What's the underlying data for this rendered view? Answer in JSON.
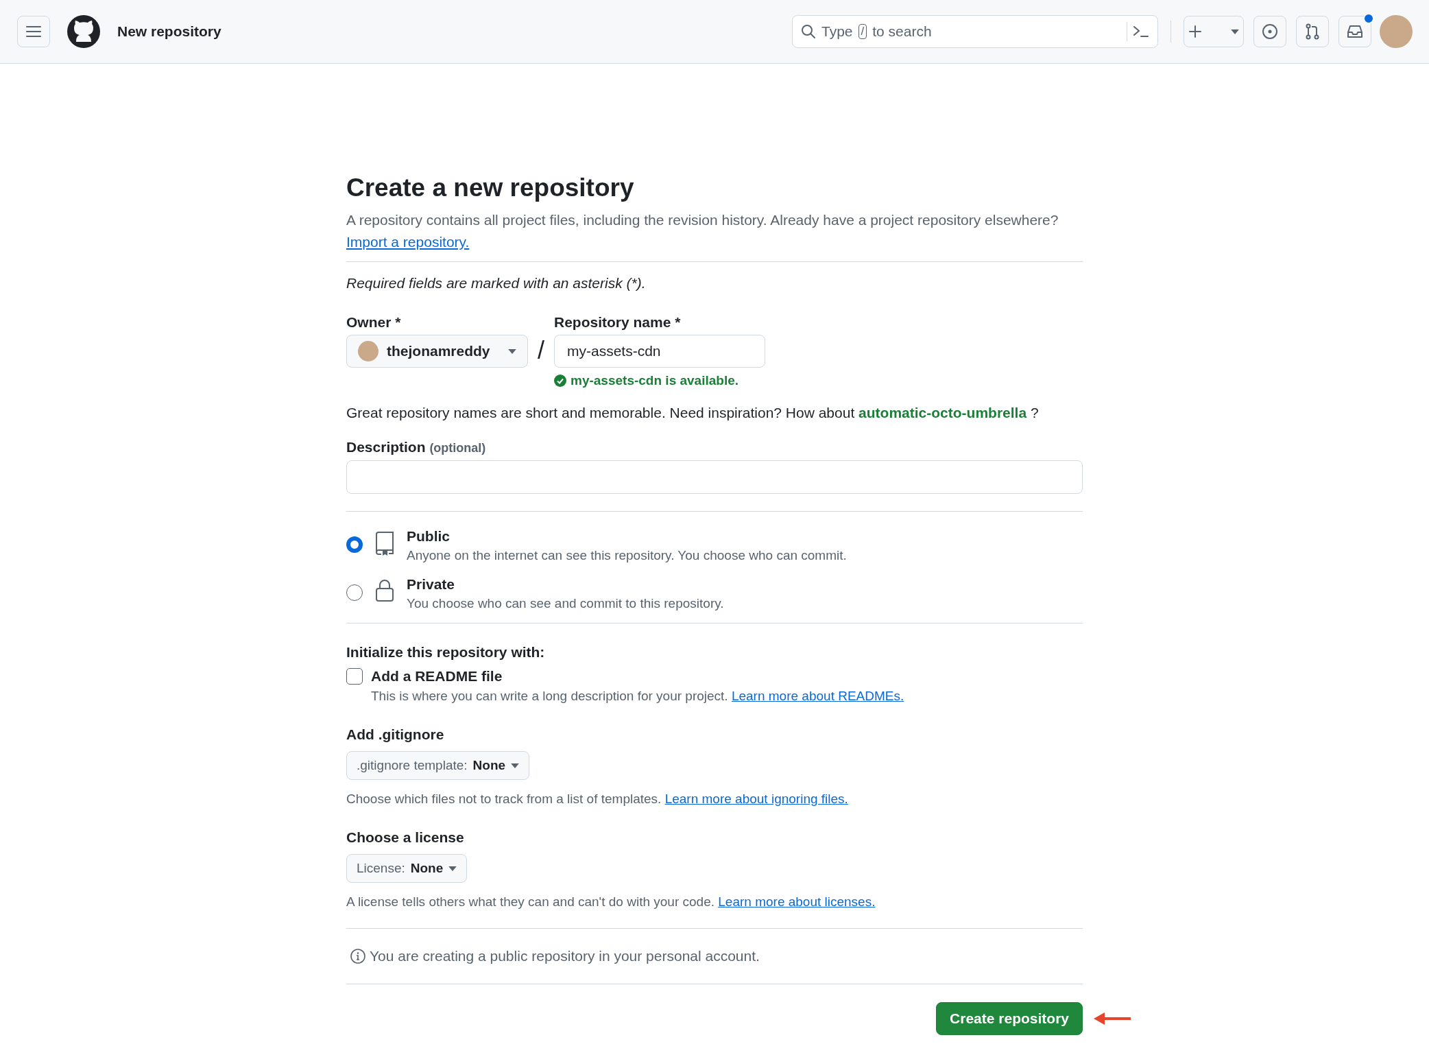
{
  "header": {
    "title": "New repository",
    "search": {
      "prefix": "Type",
      "key": "/",
      "suffix": "to search"
    },
    "inbox": {
      "unread": true
    }
  },
  "page": {
    "title": "Create a new repository",
    "intro": "A repository contains all project files, including the revision history. Already have a project repository elsewhere?",
    "intro_link": "Import a repository.",
    "required_note": "Required fields are marked with an asterisk (*).",
    "owner": {
      "label": "Owner *",
      "value": "thejonamreddy"
    },
    "separator": "/",
    "repo_name": {
      "label": "Repository name *",
      "value": "my-assets-cdn",
      "availability": "my-assets-cdn is available."
    },
    "suggestion": {
      "text": "Great repository names are short and memorable. Need inspiration? How about",
      "name": "automatic-octo-umbrella",
      "after": "?"
    },
    "description": {
      "label": "Description",
      "hint": "(optional)"
    },
    "visibility": [
      {
        "kind": "public",
        "title": "Public",
        "text": "Anyone on the internet can see this repository. You choose who can commit.",
        "selected": true
      },
      {
        "kind": "private",
        "title": "Private",
        "text": "You choose who can see and commit to this repository.",
        "selected": false
      }
    ],
    "initialize": {
      "heading": "Initialize this repository with:",
      "readme": {
        "label": "Add a README file",
        "text": "This is where you can write a long description for your project.",
        "link": "Learn more about READMEs.",
        "checked": false
      }
    },
    "gitignore": {
      "heading": "Add .gitignore",
      "dropdown_label": ".gitignore template:",
      "dropdown_value": "None",
      "help": "Choose which files not to track from a list of templates.",
      "link": "Learn more about ignoring files."
    },
    "license": {
      "heading": "Choose a license",
      "dropdown_label": "License:",
      "dropdown_value": "None",
      "help": "A license tells others what they can and can't do with your code.",
      "link": "Learn more about licenses."
    },
    "notice": "You are creating a public repository in your personal account.",
    "submit": "Create repository"
  }
}
